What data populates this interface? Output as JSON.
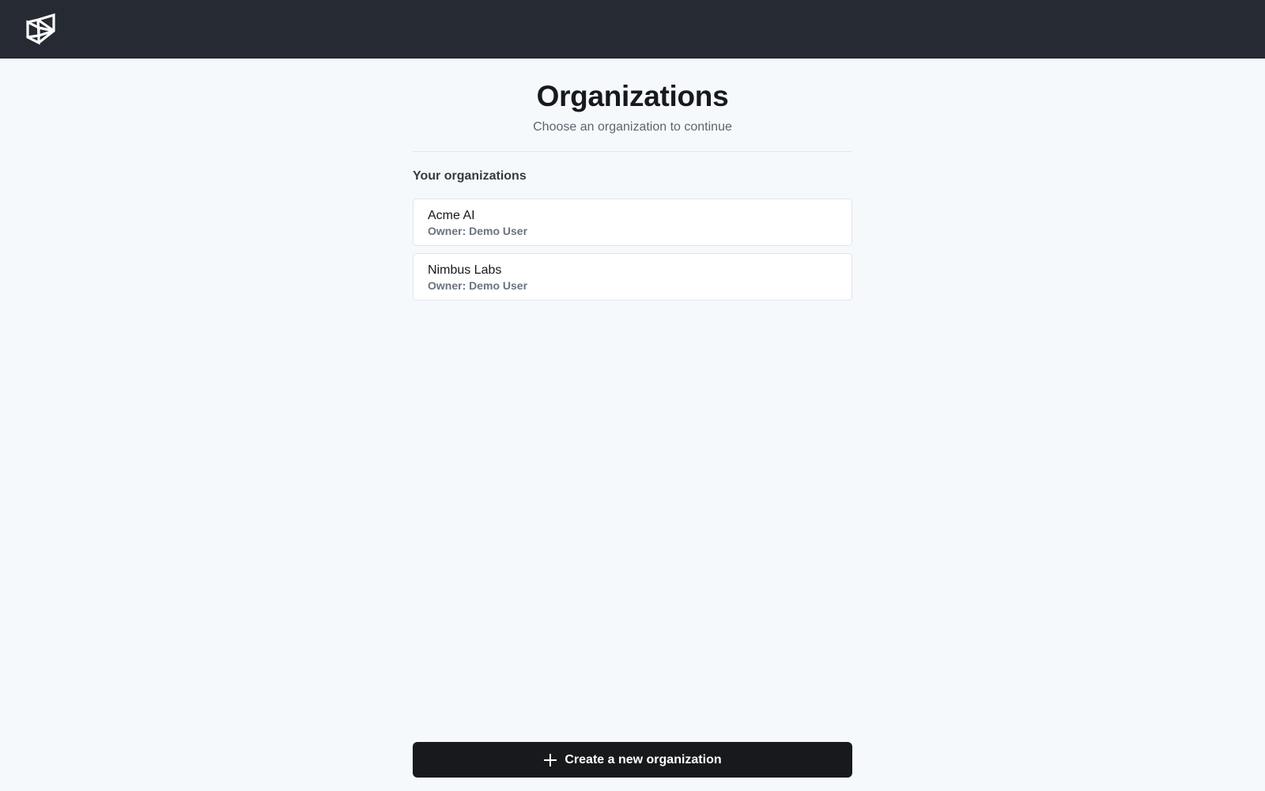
{
  "header": {
    "logo_icon": "cube-logo-icon",
    "background": "#262a32"
  },
  "main": {
    "title": "Organizations",
    "subtitle": "Choose an organization to continue",
    "section_heading": "Your organizations",
    "organizations": [
      {
        "name": "Acme AI",
        "owner": "Owner: Demo User"
      },
      {
        "name": "Nimbus Labs",
        "owner": "Owner: Demo User"
      }
    ]
  },
  "create_button": {
    "icon": "plus-icon",
    "label": "Create a new organization",
    "background": "#18191c"
  }
}
